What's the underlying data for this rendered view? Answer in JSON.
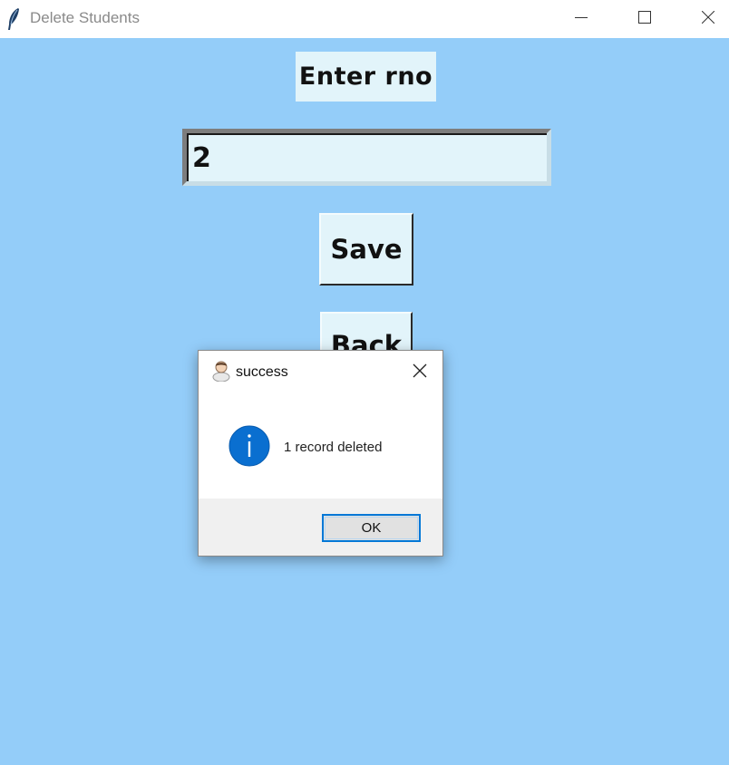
{
  "window": {
    "title": "Delete Students",
    "icon": "feather-icon",
    "controls": [
      "minimize-icon",
      "maximize-icon",
      "close-icon"
    ],
    "background": "#94cdf9"
  },
  "form": {
    "label": "Enter rno",
    "rno_value": "2",
    "save_label": "Save",
    "back_label": "Back"
  },
  "dialog": {
    "title": "success",
    "message": "1 record deleted",
    "ok_label": "OK",
    "icon": "info-icon",
    "accent": "#0078d7"
  }
}
